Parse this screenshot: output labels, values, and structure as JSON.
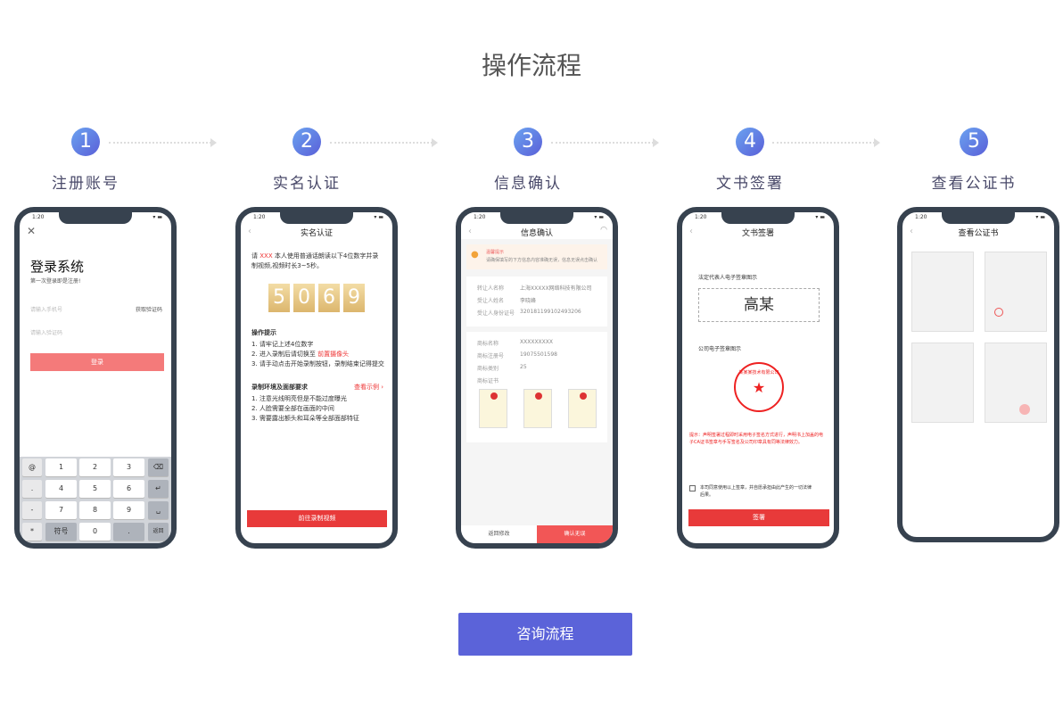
{
  "title": "操作流程",
  "steps": [
    {
      "n": "1",
      "label": "注册账号"
    },
    {
      "n": "2",
      "label": "实名认证"
    },
    {
      "n": "3",
      "label": "信息确认"
    },
    {
      "n": "4",
      "label": "文书签署"
    },
    {
      "n": "5",
      "label": "查看公证书"
    }
  ],
  "status_time": "1:20",
  "phone1": {
    "title": "登录系统",
    "subtitle": "第一次登录即是注册!",
    "phone_placeholder": "请输入手机号",
    "get_code": "获取验证码",
    "code_placeholder": "请输入验证码",
    "login": "登录",
    "keys": [
      "1",
      "2",
      "3",
      "4",
      "5",
      "6",
      "7",
      "8",
      "9",
      "0"
    ],
    "side_keys": [
      "@",
      ".",
      "-",
      "*",
      "/"
    ],
    "symbol": "符号",
    "dot": ".",
    "back": "返回"
  },
  "phone2": {
    "title": "实名认证",
    "intro_pre": "请",
    "name": "XXX",
    "intro": "本人使用普通话朗读以下4位数字并录制视频,视频时长3~5秒。",
    "digits": [
      "5",
      "0",
      "6",
      "9"
    ],
    "tips_title": "操作提示",
    "tips": [
      "1. 请牢记上述4位数字",
      "2. 进入录制后请切换至",
      "3. 请手动点击开始录制按钮，录制结束记得提交"
    ],
    "front_camera": "前置摄像头",
    "req_title": "录制环境及面部要求",
    "example": "查看示例 ›",
    "reqs": [
      "1. 注意光线明亮但是不能过度曝光",
      "2. 人脸需要全部在画面的中间",
      "3. 需要露出额头和耳朵等全部面部特征"
    ],
    "button": "前往录制视频"
  },
  "phone3": {
    "title": "信息确认",
    "notice_title": "温馨提示",
    "notice": "请确保填写的下方信息内容准确无误，信息无误点击确认",
    "rows": [
      [
        "转让人名称",
        "上海XXXXX网络科技有限公司"
      ],
      [
        "受让人姓名",
        "李晓峰"
      ],
      [
        "受让人身份证号",
        "320181199102493206"
      ]
    ],
    "rows2": [
      [
        "商标名称",
        "XXXXXXXXX"
      ],
      [
        "商标注册号",
        "19075501598"
      ],
      [
        "商标类别",
        "25"
      ],
      [
        "商标证书",
        ""
      ]
    ],
    "back": "返回修改",
    "confirm": "确认无误"
  },
  "phone4": {
    "title": "文书签署",
    "legal_label": "法定代表人电子签章图示",
    "signature": "高某",
    "company_label": "公司电子签章图示",
    "seal_text": "某某某技术有限公司",
    "warning": "提示：声明签署过程即时采用电子签名方式进行，声明书上加盖的电子CA证书签章与手写签名及公司印章具有同等法律效力。",
    "agree": "本司同意使用以上签章，并自愿承担由此产生的一切法律后果。",
    "button": "签署"
  },
  "phone5": {
    "title": "查看公证书"
  },
  "cta": "咨询流程"
}
